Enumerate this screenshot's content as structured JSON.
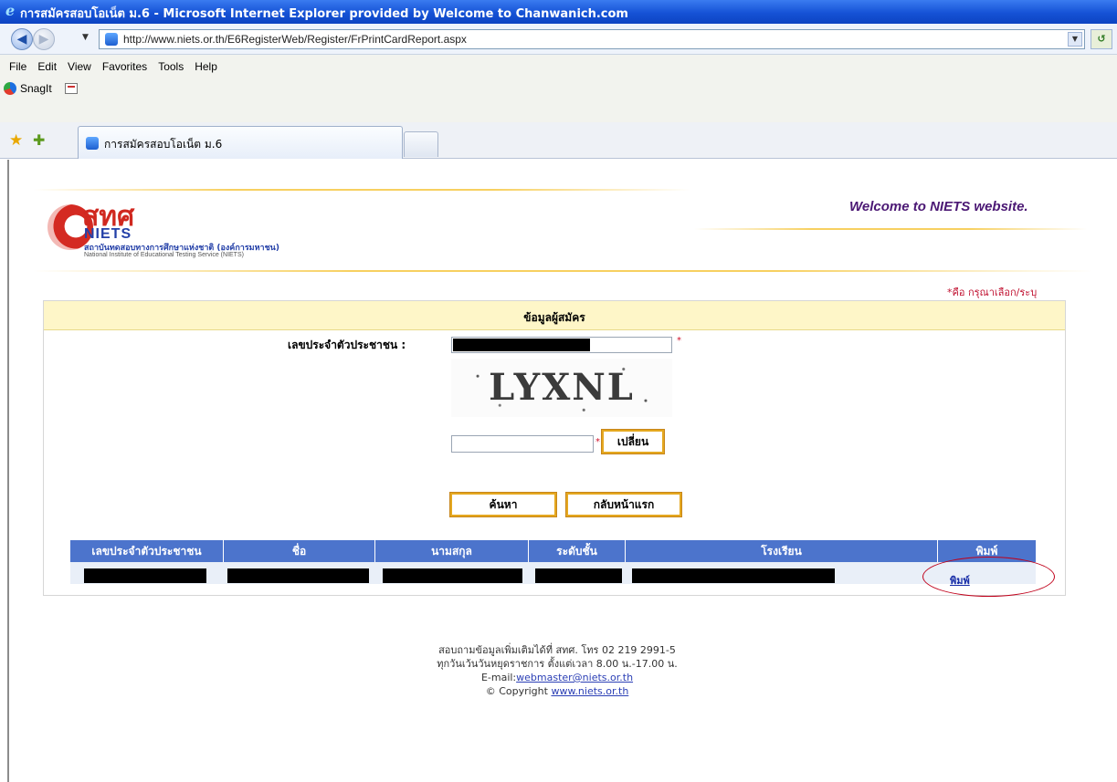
{
  "window": {
    "title": "การสมัครสอบโอเน็ต ม.6 - Microsoft Internet Explorer provided by Welcome to Chanwanich.com"
  },
  "address_bar": {
    "url": "http://www.niets.or.th/E6RegisterWeb/Register/FrPrintCardReport.aspx"
  },
  "menu": {
    "items": [
      "File",
      "Edit",
      "View",
      "Favorites",
      "Tools",
      "Help"
    ],
    "snagit_label": "SnagIt"
  },
  "tabs": [
    {
      "label": "การสมัครสอบโอเน็ต ม.6"
    }
  ],
  "header": {
    "logo_thai": "สทศ",
    "logo_abbr": "NIETS",
    "logo_thai_full": "สถาบันทดสอบทางการศึกษาแห่งชาติ (องค์การมหาชน)",
    "logo_english_full": "National Institute of Educational Testing Service (NIETS)",
    "welcome": "Welcome to NIETS website."
  },
  "form": {
    "required_note": "*คือ กรุณาเลือก/ระบุ",
    "section_title": "ข้อมูลผู้สมัคร",
    "citizen_id_label": "เลขประจำตัวประชาชน :",
    "required_mark": "*",
    "captcha_text": "LYXNL",
    "captcha_input_value": "",
    "change_button": "เปลี่ยน",
    "search_button": "ค้นหา",
    "home_button": "กลับหน้าแรก"
  },
  "results": {
    "columns": [
      "เลขประจำตัวประชาชน",
      "ชื่อ",
      "นามสกุล",
      "ระดับชั้น",
      "โรงเรียน",
      "พิมพ์"
    ],
    "print_link": "พิมพ์"
  },
  "footer": {
    "line1": "สอบถามข้อมูลเพิ่มเติมได้ที่ สทศ. โทร 02 219 2991-5",
    "line2": "ทุกวันเว้นวันหยุดราชการ ตั้งแต่เวลา 8.00 น.-17.00 น.",
    "email_prefix": "E-mail:",
    "email": "webmaster@niets.or.th",
    "copyright_prefix": "© Copyright",
    "website": "www.niets.or.th"
  },
  "colors": {
    "titlebar": "#1552d6",
    "table_header": "#4c74cc",
    "panel_header": "#fef6c8",
    "button_border": "#e5a820",
    "required": "#d0102a"
  }
}
